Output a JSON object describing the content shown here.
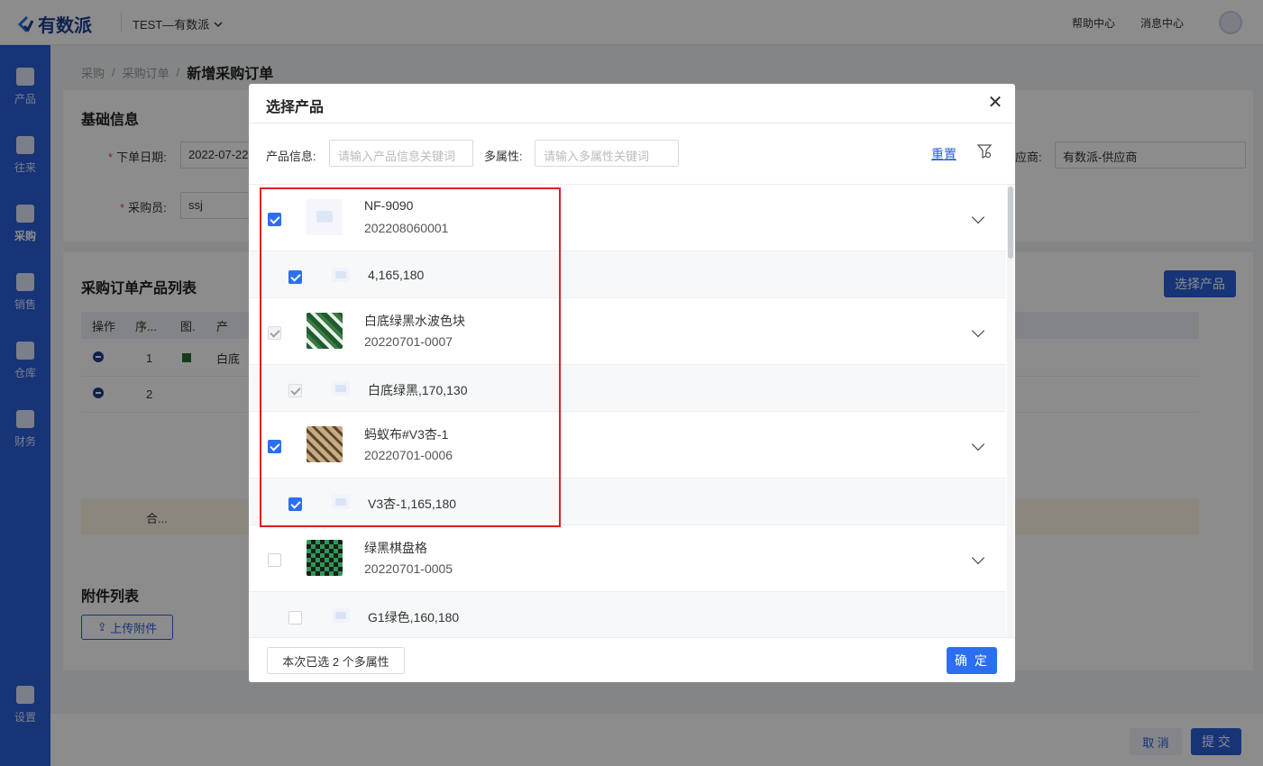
{
  "app": {
    "logo": "有数派",
    "workspace": "TEST—有数派",
    "help": "帮助中心",
    "messages": "消息中心"
  },
  "sidebar": [
    {
      "label": "产品"
    },
    {
      "label": "往来"
    },
    {
      "label": "采购"
    },
    {
      "label": "销售"
    },
    {
      "label": "仓库"
    },
    {
      "label": "财务"
    },
    {
      "label": "设置"
    }
  ],
  "breadcrumb": {
    "level1": "采购",
    "level2": "采购订单",
    "current": "新增采购订单",
    "sep": "/"
  },
  "basic": {
    "title": "基础信息",
    "order_date_label": "下单日期:",
    "order_date": "2022-07-22",
    "buyer_label": "采购员:",
    "buyer": "ssj",
    "supplier_label": "应商:",
    "supplier": "有数派-供应商"
  },
  "product_list": {
    "title": "采购订单产品列表",
    "select_button": "选择产品",
    "headers": [
      "操作",
      "序...",
      "图.",
      "产"
    ],
    "rows": [
      {
        "index": "1",
        "name": "白底"
      },
      {
        "index": "2",
        "name": ""
      }
    ],
    "total_label": "合..."
  },
  "attachments": {
    "title": "附件列表",
    "upload": "上传附件"
  },
  "footer": {
    "cancel": "取 消",
    "submit": "提 交"
  },
  "modal": {
    "title": "选择产品",
    "filter": {
      "product_label": "产品信息:",
      "product_placeholder": "请输入产品信息关键词",
      "attr_label": "多属性:",
      "attr_placeholder": "请输入多属性关键词",
      "reset": "重置"
    },
    "items": [
      {
        "name": "NF-9090",
        "code": "202208060001",
        "state": "checked",
        "thumb": "placeholder",
        "child": {
          "name": "4,165,180",
          "state": "checked"
        }
      },
      {
        "name": "白底绿黑水波色块",
        "code": "20220701-0007",
        "state": "disabled",
        "thumb": "p1",
        "child": {
          "name": "白底绿黑,170,130",
          "state": "disabled"
        }
      },
      {
        "name": "蚂蚁布#V3杏-1",
        "code": "20220701-0006",
        "state": "checked",
        "thumb": "p2",
        "child": {
          "name": "V3杏-1,165,180",
          "state": "checked"
        }
      },
      {
        "name": "绿黑棋盘格",
        "code": "20220701-0005",
        "state": "unchecked",
        "thumb": "p3",
        "child": {
          "name": "G1绿色,160,180",
          "state": "unchecked"
        }
      }
    ],
    "summary": "本次已选 2 个多属性",
    "confirm": "确 定"
  }
}
